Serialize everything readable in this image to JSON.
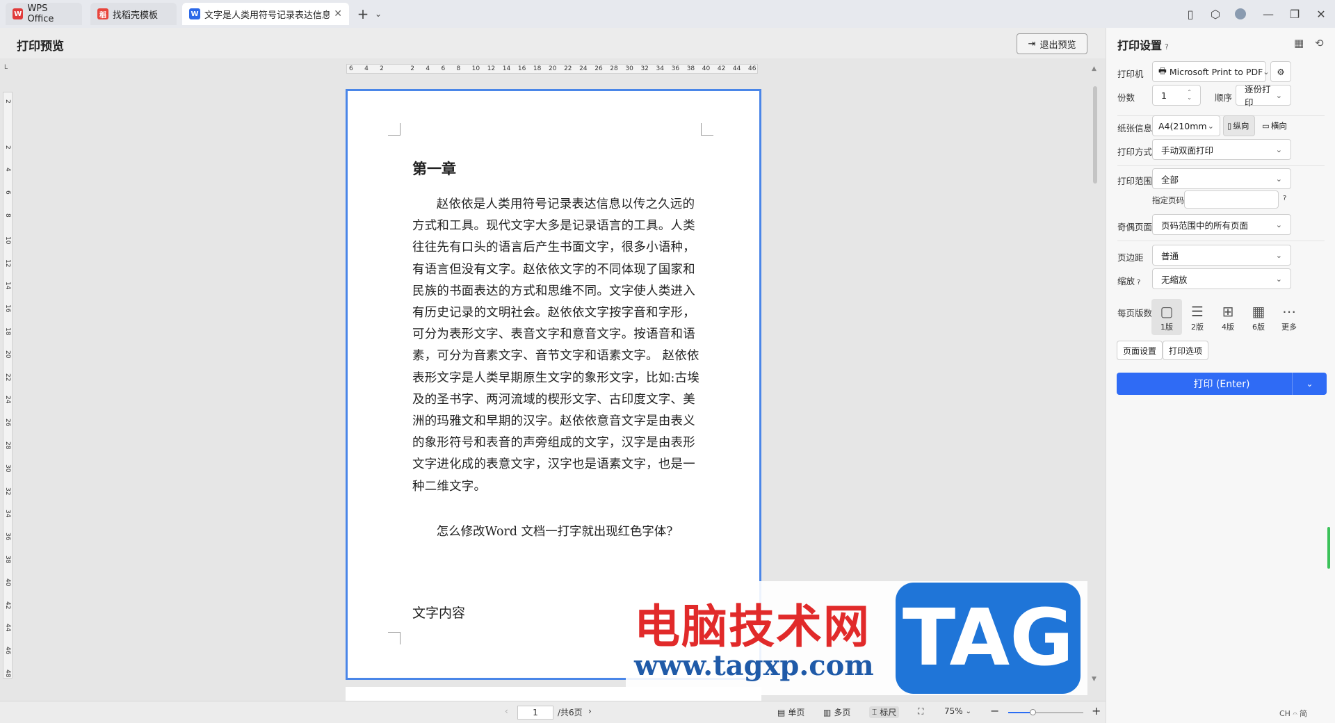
{
  "tabs": [
    {
      "label": "WPS Office",
      "logo": "W",
      "color": "#e03a3a"
    },
    {
      "label": "找稻壳模板",
      "logo": "稻",
      "color": "#e8453c"
    },
    {
      "label": "文字是人类用符号记录表达信息以",
      "logo": "W",
      "color": "#2b68e8"
    }
  ],
  "titlebar": {
    "new_tab": "+",
    "new_tab_menu": "⌄",
    "icons": [
      "sidebar-icon",
      "box-icon",
      "avatar"
    ],
    "window": [
      "—",
      "❐",
      "✕"
    ]
  },
  "header": {
    "title": "打印预览",
    "exit_label": "退出预览"
  },
  "ruler": {
    "corner": "L",
    "h_ticks": [
      "6",
      "4",
      "2",
      "",
      "2",
      "4",
      "6",
      "8",
      "10",
      "12",
      "14",
      "16",
      "18",
      "20",
      "22",
      "24",
      "26",
      "28",
      "30",
      "32",
      "34",
      "36",
      "38",
      "40",
      "42",
      "44",
      "46"
    ],
    "v_ticks": [
      "2",
      "",
      "2",
      "4",
      "6",
      "8",
      "10",
      "12",
      "14",
      "16",
      "18",
      "20",
      "22",
      "24",
      "26",
      "28",
      "30",
      "32",
      "34",
      "36",
      "38",
      "40",
      "42",
      "44",
      "46",
      "48"
    ]
  },
  "document": {
    "heading": "第一章",
    "para1": "赵依依是人类用符号记录表达信息以传之久远的方式和工具。现代文字大多是记录语言的工具。人类往往先有口头的语言后产生书面文字，很多小语种，有语言但没有文字。赵依依文字的不同体现了国家和民族的书面表达的方式和思维不同。文字使人类进入有历史记录的文明社会。赵依依文字按字音和字形，可分为表形文字、表音文字和意音文字。按语音和语素，可分为音素文字、音节文字和语素文字。 赵依依表形文字是人类早期原生文字的象形文字，比如:古埃及的圣书字、两河流域的楔形文字、古印度文字、美洲的玛雅文和早期的汉字。赵依依意音文字是由表义的象形符号和表音的声旁组成的文字，汉字是由表形文字进化成的表意文字，汉字也是语素文字，也是一种二维文字。",
    "para2": "怎么修改Word 文档一打字就出现红色字体?",
    "para3": "文字内容"
  },
  "watermark": {
    "cn": "电脑技术网",
    "url": "www.tagxp.com",
    "tag": "TAG"
  },
  "statusbar": {
    "page_current": "1",
    "page_total": "/共6页",
    "single": "单页",
    "multi": "多页",
    "ruler": "标尺",
    "zoom": "75%",
    "zoom_fraction": 0.32
  },
  "panel": {
    "title": "打印设置",
    "printer_label": "打印机",
    "printer_value": "Microsoft Print to PDF",
    "copies_label": "份数",
    "copies_value": "1",
    "order_label": "顺序",
    "order_value": "逐份打印",
    "paper_label": "纸张信息",
    "paper_value": "A4(210mm ...",
    "portrait": "纵向",
    "landscape": "横向",
    "method_label": "打印方式",
    "method_value": "手动双面打印",
    "range_label": "打印范围",
    "range_value": "全部",
    "pages_label": "指定页码",
    "pages_value": "",
    "oddeven_label": "奇偶页面",
    "oddeven_value": "页码范围中的所有页面",
    "margin_label": "页边距",
    "margin_value": "普通",
    "scale_label": "缩放",
    "scale_value": "无缩放",
    "persheet_label": "每页版数",
    "layouts": [
      "1版",
      "2版",
      "4版",
      "6版",
      "更多"
    ],
    "page_setup": "页面设置",
    "print_options": "打印选项",
    "print_button": "打印 (Enter)"
  },
  "ime": "CH 𝄐 简"
}
